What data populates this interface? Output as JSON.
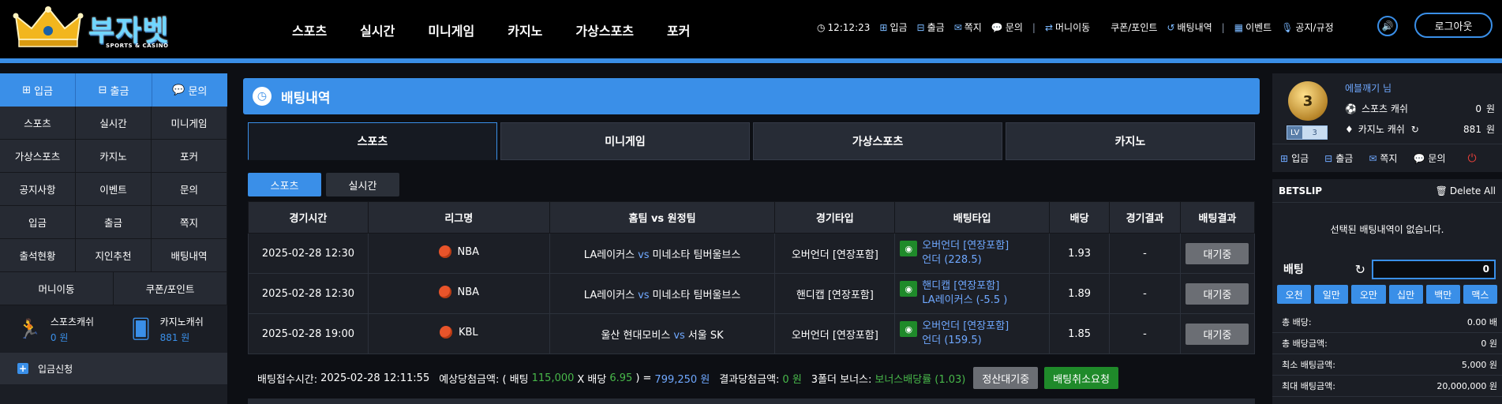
{
  "brand": {
    "name": "부자벳",
    "sub": "SPORTS & CASINO"
  },
  "main_nav": [
    "스포츠",
    "실시간",
    "미니게임",
    "카지노",
    "가상스포츠",
    "포커"
  ],
  "top_bar": {
    "time": "12:12:23",
    "items": [
      {
        "icon": "plus-square-icon",
        "label": "입금"
      },
      {
        "icon": "minus-square-icon",
        "label": "출금"
      },
      {
        "icon": "envelope-icon",
        "label": "쪽지"
      },
      {
        "icon": "chat-icon",
        "label": "문의"
      },
      {
        "icon": "exchange-icon",
        "label": "머니이동"
      },
      {
        "icon": "",
        "label": "쿠폰/포인트"
      },
      {
        "icon": "history-icon",
        "label": "배팅내역"
      },
      {
        "icon": "calendar-icon",
        "label": "이벤트"
      },
      {
        "icon": "mic-icon",
        "label": "공지/규정"
      }
    ],
    "logout": "로그아웃"
  },
  "left_sidebar": {
    "quick": [
      {
        "icon": "plus-square-icon",
        "label": "입금"
      },
      {
        "icon": "minus-square-icon",
        "label": "출금"
      },
      {
        "icon": "chat-icon",
        "label": "문의"
      }
    ],
    "grid": [
      "스포츠",
      "실시간",
      "미니게임",
      "가상스포츠",
      "카지노",
      "포커",
      "공지사항",
      "이벤트",
      "문의",
      "입금",
      "출금",
      "쪽지",
      "출석현황",
      "지인추천",
      "배팅내역"
    ],
    "grid2": [
      "머니이동",
      "쿠폰/포인트"
    ],
    "wallets": [
      {
        "title": "스포츠캐쉬",
        "value": "0 원"
      },
      {
        "title": "카지노캐쉬",
        "value": "881 원"
      }
    ],
    "deposit_request": "입금신청"
  },
  "center": {
    "title": "배팅내역",
    "tabs": [
      "스포츠",
      "미니게임",
      "가상스포츠",
      "카지노"
    ],
    "subtabs": [
      "스포츠",
      "실시간"
    ],
    "table": {
      "headers": [
        "경기시간",
        "리그명",
        "홈팀 vs 원정팀",
        "경기타입",
        "배팅타입",
        "배당",
        "경기결과",
        "배팅결과"
      ],
      "vs": "vs",
      "rows": [
        {
          "time": "2025-02-28 12:30",
          "league": "NBA",
          "home": "LA레이커스",
          "away": "미네소타 팀버울브스",
          "type": "오버언더 [연장포함]",
          "sel1": "오버언더 [연장포함]",
          "sel2": "언더 (228.5)",
          "odds": "1.93",
          "result": "-",
          "status": "대기중"
        },
        {
          "time": "2025-02-28 12:30",
          "league": "NBA",
          "home": "LA레이커스",
          "away": "미네소타 팀버울브스",
          "type": "핸디캡 [연장포함]",
          "sel1": "핸디캡 [연장포함]",
          "sel2": "LA레이커스 (-5.5 )",
          "odds": "1.89",
          "result": "-",
          "status": "대기중"
        },
        {
          "time": "2025-02-28 19:00",
          "league": "KBL",
          "home": "울산 현대모비스",
          "away": "서울 SK",
          "type": "오버언더 [연장포함]",
          "sel1": "오버언더 [연장포함]",
          "sel2": "언더 (159.5)",
          "odds": "1.85",
          "result": "-",
          "status": "대기중"
        }
      ]
    },
    "summary": {
      "receipt_label": "배팅접수시간:",
      "receipt_time": "2025-02-28 12:11:55",
      "expected_label": "예상당첨금액: ( 배팅",
      "bet_amount": "115,000",
      "x_label": "X 배당",
      "total_odds": "6.95",
      "eq": ") =",
      "expected_amount": "799,250 원",
      "result_label": "결과당첨금액:",
      "result_amount": "0 원",
      "bonus_label": "3폴더 보너스:",
      "bonus_value": "보너스배당률 (1.03)",
      "settle_btn": "정산대기중",
      "cancel_btn": "배팅취소요청"
    }
  },
  "right_sidebar": {
    "level_badge": "3",
    "lv_label": "LV",
    "lv_value": "3",
    "username": "에블깨기 님",
    "balances": [
      {
        "icon": "sports-icon",
        "label": "스포츠 캐쉬",
        "amount": "0",
        "unit": "원"
      },
      {
        "icon": "diamond-icon",
        "label": "카지노 캐쉬",
        "amount": "881",
        "unit": "원"
      }
    ],
    "quick": [
      {
        "icon": "plus-square-icon",
        "label": "입금"
      },
      {
        "icon": "minus-square-icon",
        "label": "출금"
      },
      {
        "icon": "envelope-icon",
        "label": "쪽지"
      },
      {
        "icon": "chat-icon",
        "label": "문의"
      }
    ],
    "betslip": {
      "title": "BETSLIP",
      "delete_all": "Delete All",
      "empty": "선택된 배팅내역이 없습니다.",
      "bet_label": "배팅",
      "bet_value": "0",
      "chips": [
        "오천",
        "일만",
        "오만",
        "십만",
        "백만",
        "맥스"
      ],
      "stats": [
        {
          "label": "총 배당:",
          "value": "0.00 배"
        },
        {
          "label": "총 배당금액:",
          "value": "0 원"
        },
        {
          "label": "최소 배팅금액:",
          "value": "5,000 원"
        },
        {
          "label": "최대 배팅금액:",
          "value": "20,000,000 원"
        }
      ]
    }
  },
  "colors": {
    "accent": "#3a8fe8",
    "green": "#1f8a2a",
    "pending": "#6b6e74"
  }
}
